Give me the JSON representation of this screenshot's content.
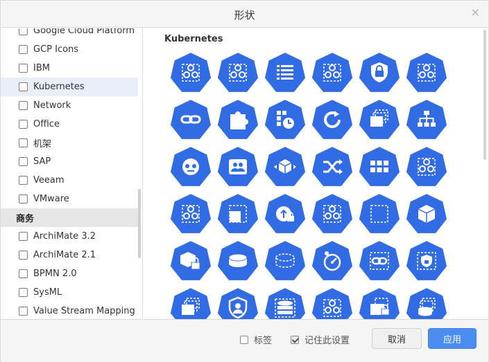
{
  "dialog": {
    "title": "形状",
    "close_label": "×"
  },
  "sidebar": {
    "items_before_section": [
      {
        "label": "Google Cloud Platform",
        "checked": false
      },
      {
        "label": "GCP Icons",
        "checked": false
      },
      {
        "label": "IBM",
        "checked": false
      },
      {
        "label": "Kubernetes",
        "checked": false,
        "selected": true
      },
      {
        "label": "Network",
        "checked": false
      },
      {
        "label": "Office",
        "checked": false
      },
      {
        "label": "机架",
        "checked": false
      },
      {
        "label": "SAP",
        "checked": false
      },
      {
        "label": "Veeam",
        "checked": false
      },
      {
        "label": "VMware",
        "checked": false
      }
    ],
    "section_label": "商务",
    "items_after_section": [
      {
        "label": "ArchiMate 3.2",
        "checked": false
      },
      {
        "label": "ArchiMate 2.1",
        "checked": false
      },
      {
        "label": "BPMN 2.0",
        "checked": false
      },
      {
        "label": "SysML",
        "checked": false
      },
      {
        "label": "Value Stream Mapping",
        "checked": false
      }
    ]
  },
  "main": {
    "section_title": "Kubernetes",
    "accent_color": "#326ce5",
    "shapes": [
      [
        "k8s-gear-cluster-icon",
        "k8s-gear-cluster-icon",
        "list-icon",
        "k8s-gear-cluster-icon",
        "lock-badge-icon",
        "k8s-gear-cluster-icon"
      ],
      [
        "link-icon",
        "puzzle-icon",
        "cronjob-icon",
        "refresh-icon",
        "stacked-pages-icon",
        "hierarchy-icon"
      ],
      [
        "robot-head-icon",
        "group-card-icon",
        "cube-arrows-icon",
        "shuffle-icon",
        "grid-icon",
        "k8s-gear-cluster-icon"
      ],
      [
        "k8s-gear-cluster-icon",
        "dashed-square-icon",
        "upload-lock-icon",
        "k8s-gear-cluster-icon",
        "dashed-frame-icon",
        "cube-icon"
      ],
      [
        "cube-lock-icon",
        "disk-icon",
        "dashed-disk-icon",
        "gauge-icon",
        "dashed-link-icon",
        "dashed-lock-icon"
      ],
      [
        "stacked-pages-icon",
        "user-shield-icon",
        "database-icon",
        "k8s-gear-cluster-icon",
        "lock-pages-icon",
        "disk-pages-icon"
      ]
    ]
  },
  "footer": {
    "labels_option": "标签",
    "labels_checked": false,
    "remember_option": "记住此设置",
    "remember_checked": true,
    "cancel_label": "取消",
    "apply_label": "应用"
  }
}
